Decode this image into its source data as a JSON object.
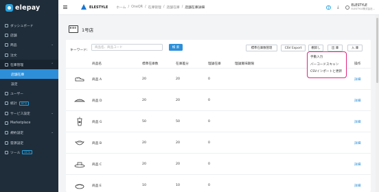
{
  "brand": {
    "name": "elepay"
  },
  "sidebar": {
    "items": [
      {
        "label": "ダッシュボード",
        "icon": "clock-icon"
      },
      {
        "label": "店舗",
        "icon": "store-icon"
      },
      {
        "label": "商品",
        "icon": "cart-icon",
        "chevron": "⌄"
      },
      {
        "label": "注文",
        "icon": "order-icon"
      },
      {
        "label": "在庫管理",
        "icon": "inventory-icon",
        "chevron": "⌃"
      },
      {
        "label": "店舗在庫",
        "sub": true,
        "active": true
      },
      {
        "label": "設定",
        "sub": true
      },
      {
        "label": "ユーザー",
        "icon": "user-icon"
      },
      {
        "label": "統計",
        "icon": "chart-icon",
        "badge": "BETA"
      },
      {
        "label": "サービス設定",
        "icon": "gear-icon",
        "chevron": "⌄"
      },
      {
        "label": "Marketplace",
        "icon": "grid-icon"
      },
      {
        "label": "規約設定",
        "icon": "doc-icon",
        "chevron": "⌄"
      },
      {
        "label": "雲源設定",
        "icon": "cloud-icon"
      },
      {
        "label": "ツール",
        "icon": "tool-icon",
        "badge": "BETA"
      }
    ]
  },
  "header": {
    "org": "ELESTYLE",
    "breadcrumbs": [
      "ホーム",
      "/",
      "OneQR",
      "/",
      "在庫管理",
      "/",
      "店舗在庫",
      "/",
      "店舗在庫詳細"
    ],
    "help": "?",
    "download_icon": "⤓",
    "user_name": "ELESTYLE",
    "user_company": "ELESTYLE株式会社..."
  },
  "page": {
    "title": "1号店"
  },
  "filter": {
    "keyword_label": "キーワード:",
    "placeholder": "商品名、商品コード",
    "search_label": "検 索"
  },
  "actions": {
    "standard_stock": "標準在庫数管理",
    "csv_export": "CSV Export",
    "stocktake": "棚卸し",
    "out": "出 庫",
    "in": "入 庫"
  },
  "dropdown": {
    "items": [
      "手動入力",
      "バーコードスキャン",
      "CSVインポートと更新"
    ]
  },
  "table": {
    "headers": [
      "商品名",
      "標準在庫数",
      "在庫差分",
      "理論在庫",
      "理論賞味期限",
      "操作"
    ],
    "rows": [
      {
        "name": "商品 A",
        "standard": "20",
        "diff": "20",
        "theory": "0",
        "action": "詳細",
        "thumb": "shoe"
      },
      {
        "name": "商品 D",
        "standard": "20",
        "diff": "20",
        "theory": "0",
        "action": "詳細",
        "thumb": "pie"
      },
      {
        "name": "商品 G",
        "standard": "50",
        "diff": "50",
        "theory": "0",
        "action": "詳細",
        "thumb": "cup"
      },
      {
        "name": "商品 B",
        "standard": "20",
        "diff": "20",
        "theory": "0",
        "action": "詳細",
        "thumb": "bowl"
      },
      {
        "name": "商品 C",
        "standard": "20",
        "diff": "20",
        "theory": "0",
        "action": "詳細",
        "thumb": "plate"
      },
      {
        "name": "商品 E",
        "standard": "10",
        "diff": "10",
        "theory": "0",
        "action": "詳細",
        "thumb": "roll"
      }
    ]
  }
}
